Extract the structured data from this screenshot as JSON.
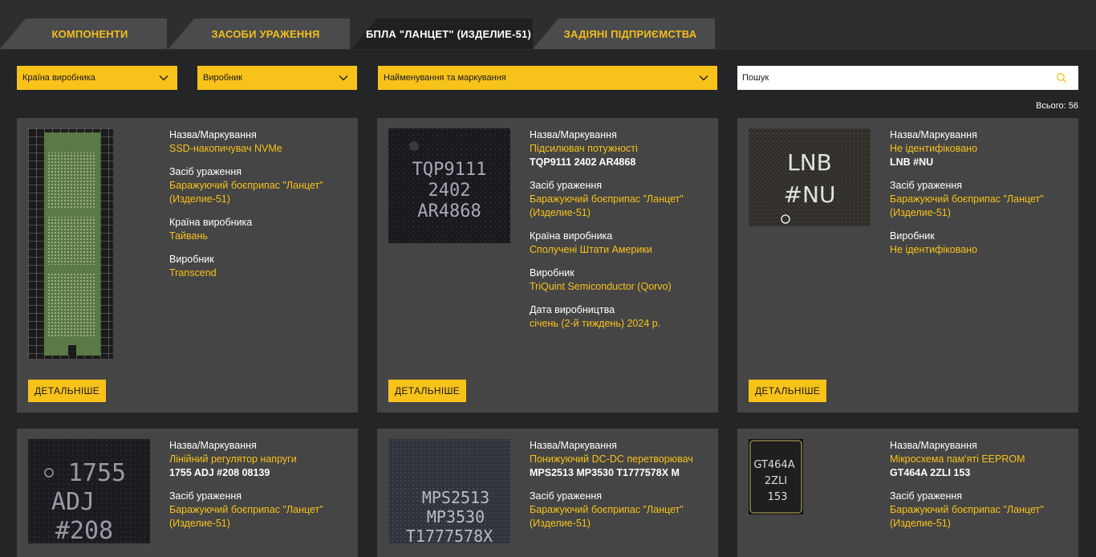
{
  "tabs": [
    {
      "label": "КОМПОНЕНТИ"
    },
    {
      "label": "ЗАСОБИ УРАЖЕННЯ"
    },
    {
      "label": "БПЛА \"ЛАНЦЕТ\" (ИЗДЕЛИЕ-51)"
    },
    {
      "label": "ЗАДІЯНІ ПІДПРИЄМСТВА"
    }
  ],
  "filters": {
    "country": "Країна виробника",
    "manufacturer": "Виробник",
    "name": "Найменування та маркування",
    "search_placeholder": "Пошук"
  },
  "total": "Всього: 56",
  "labels": {
    "name": "Назва/Маркування",
    "weapon": "Засіб ураження",
    "country": "Країна виробника",
    "manufacturer": "Виробник",
    "date": "Дата виробництва",
    "more": "ДЕТАЛЬНІШЕ"
  },
  "cards": [
    {
      "name": "SSD-накопичувач NVMe",
      "weapon": "Баражуючий боєприпас \"Ланцет\" (Изделие-51)",
      "country": "Тайвань",
      "manufacturer": "Transcend"
    },
    {
      "name": "Підсилювач потужності",
      "code": "TQP9111 2402 AR4868",
      "weapon": "Баражуючий боєприпас \"Ланцет\" (Изделие-51)",
      "country": "Сполучені Штати Америки",
      "manufacturer": "TriQuint Semiconductor (Qorvo)",
      "date": "січень (2-й тиждень) 2024 р.",
      "marking": [
        "TQP9111",
        "2402",
        "AR4868"
      ]
    },
    {
      "name": "Не ідентифіковано",
      "code": "LNB #NU",
      "weapon": "Баражуючий боєприпас \"Ланцет\" (Изделие-51)",
      "manufacturer": "Не ідентифіковано",
      "marking": [
        "LNB",
        "#NU"
      ]
    },
    {
      "name": "Лінійний регулятор напруги",
      "code": "1755 ADJ #208 08139",
      "weapon": "Баражуючий боєприпас \"Ланцет\" (Изделие-51)",
      "marking": [
        "1755",
        "ADJ",
        "#208"
      ]
    },
    {
      "name": "Понижуючий DC-DC перетворювач",
      "code": "MPS2513 MP3530 T1777578X M",
      "weapon": "Баражуючий боєприпас \"Ланцет\" (Изделие-51)",
      "marking": [
        "MPS2513",
        "MP3530",
        "T1777578X"
      ]
    },
    {
      "name": "Мікросхема пам'яті EEPROM",
      "code": "GT464A 2ZLI 153",
      "weapon": "Баражуючий боєприпас \"Ланцет\" (Изделие-51)",
      "marking": [
        "GT464A",
        "2ZLI",
        "153"
      ]
    }
  ],
  "colors": {
    "accent": "#f7c21a",
    "card": "#454545",
    "background": "#242526"
  },
  "icons": {
    "dropdown": "chevron-down-icon",
    "search": "search-icon"
  }
}
